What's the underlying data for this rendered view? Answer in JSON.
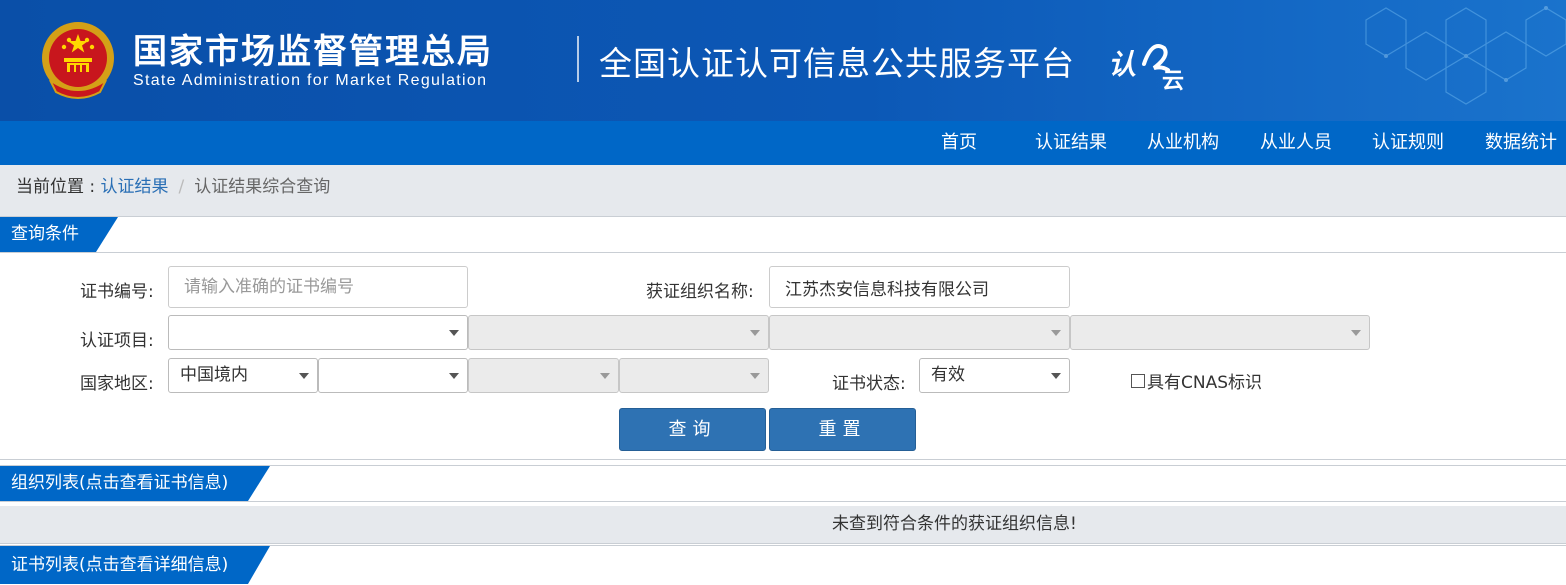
{
  "header": {
    "title_cn": "国家市场监督管理总局",
    "title_en": "State Administration  for  Market Regulation",
    "platform": "全国认证认可信息公共服务平台",
    "emblem_icon": "national-emblem-icon",
    "logo_icon": "renzheng-cloud-logo-icon",
    "brand_color": "#0a4fa8"
  },
  "nav": {
    "items": [
      {
        "label": "首页"
      },
      {
        "label": "认证结果"
      },
      {
        "label": "从业机构"
      },
      {
        "label": "从业人员"
      },
      {
        "label": "认证规则"
      },
      {
        "label": "数据统计"
      }
    ],
    "color": "#0067c7"
  },
  "breadcrumb": {
    "prefix": "当前位置 : ",
    "link": "认证结果",
    "separator": "/",
    "current": "认证结果综合查询"
  },
  "query_section": {
    "title": "查询条件",
    "cert_no_label": "证书编号:",
    "cert_no_placeholder": "请输入准确的证书编号",
    "org_name_label": "获证组织名称:",
    "org_name_value": "江苏杰安信息科技有限公司",
    "project_label": "认证项目:",
    "project_selects": [
      "",
      "",
      "",
      ""
    ],
    "region_label": "国家地区:",
    "region_selects": [
      "中国境内",
      "",
      "",
      ""
    ],
    "status_label": "证书状态:",
    "status_value": "有效",
    "cnas_label": "具有CNAS标识",
    "cnas_checked": false,
    "query_button": "查询",
    "reset_button": "重置"
  },
  "org_section": {
    "title": "组织列表(点击查看证书信息)",
    "empty_message": "未查到符合条件的获证组织信息!"
  },
  "cert_section": {
    "title": "证书列表(点击查看详细信息)"
  }
}
